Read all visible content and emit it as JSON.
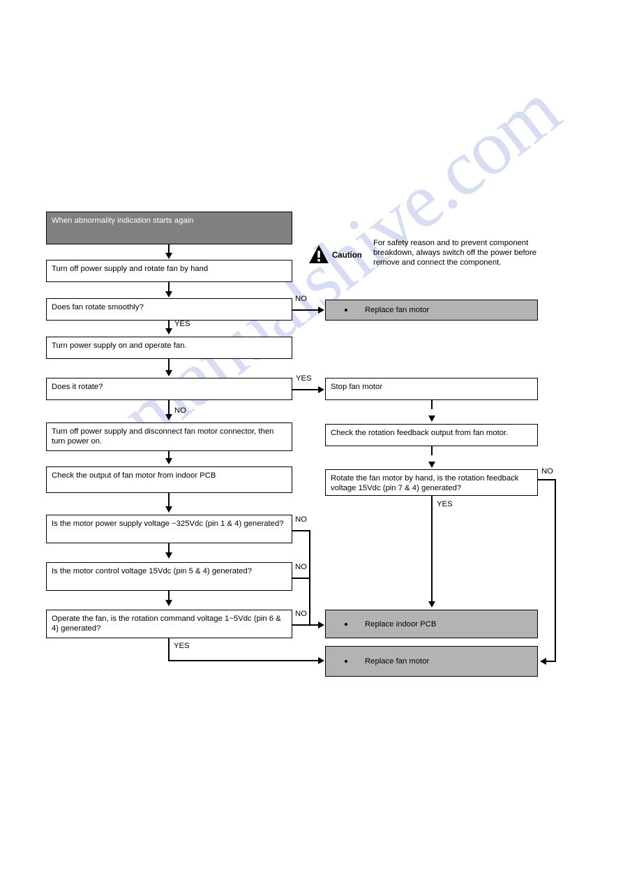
{
  "diagram": {
    "title": "When abnormality indication starts again",
    "header": {
      "label": "When abnormality indication starts again"
    },
    "caution": {
      "icon": "warning-triangle-icon",
      "caption": "Caution",
      "text": "For safety reason and to prevent component breakdown, always switch off the power before remove and connect the component."
    },
    "left_column": [
      {
        "id": "l1",
        "label": "Turn off power supply and rotate fan by hand"
      },
      {
        "id": "l2",
        "label": "Does fan rotate smoothly?"
      },
      {
        "id": "l3",
        "label": "Turn power supply on and operate fan."
      },
      {
        "id": "l4",
        "label": "Does it rotate?"
      },
      {
        "id": "l5",
        "label": "Turn off power supply and disconnect fan motor connector, then turn power on."
      },
      {
        "id": "l6",
        "label": "Check the output of fan motor from indoor PCB"
      },
      {
        "id": "l7",
        "label": "Is the motor power supply voltage ~325Vdc (pin 1 & 4) generated?"
      },
      {
        "id": "l8",
        "label": "Is the motor control voltage 15Vdc (pin 5 & 4) generated?"
      },
      {
        "id": "l9",
        "label": "Operate the fan, is the rotation command voltage 1~5Vdc (pin 6 & 4) generated?"
      }
    ],
    "right_column": [
      {
        "id": "r1",
        "label": "Stop fan motor"
      },
      {
        "id": "r2",
        "label": "Check the rotation feedback output from fan motor."
      },
      {
        "id": "r3",
        "label": "Rotate the fan motor by hand, is the rotation feedback voltage 15Vdc (pin 7 & 4) generated?"
      }
    ],
    "results": [
      {
        "id": "res_fan_top",
        "label": "Replace fan motor"
      },
      {
        "id": "res_pcb",
        "label": "Replace indoor PCB"
      },
      {
        "id": "res_fan_bottom",
        "label": "Replace fan motor"
      }
    ],
    "edge_labels": {
      "no_fan_rotate": "NO",
      "yes_fan_rotate": "YES",
      "yes_it_rotate": "YES",
      "no_it_rotate": "NO",
      "no_325vdc": "NO",
      "no_15vdc": "NO",
      "no_command": "NO",
      "yes_command": "YES",
      "no_feedback": "NO",
      "yes_feedback": "YES"
    },
    "watermark": "manualshive.com",
    "colors": {
      "header_fill": "#808080",
      "result_fill": "#b3b3b3",
      "box_fill": "#ffffff",
      "stroke": "#000000",
      "watermark": "#c9d2ef"
    }
  }
}
